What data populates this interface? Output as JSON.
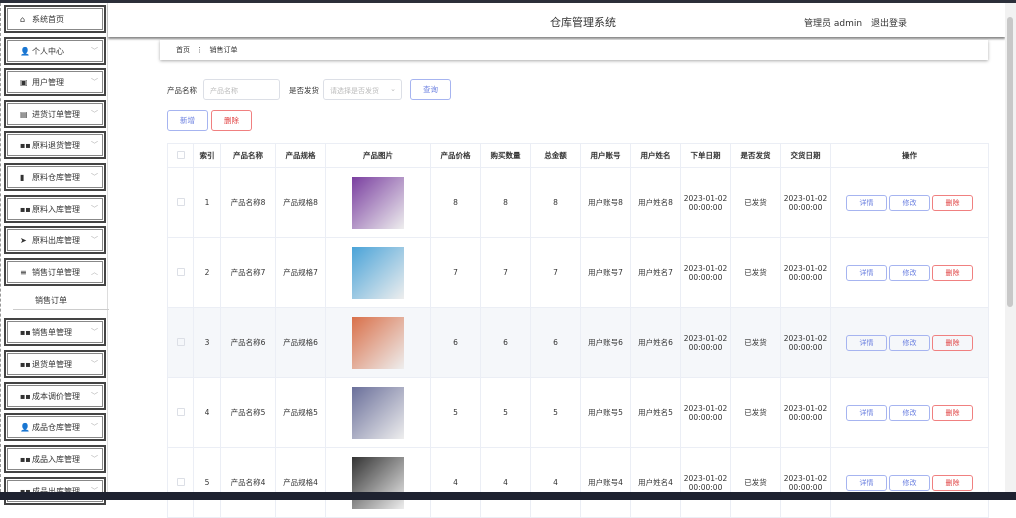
{
  "header": {
    "title": "仓库管理系统",
    "user": "管理员 admin",
    "logout": "退出登录"
  },
  "sidebar": {
    "items": [
      {
        "label": "系统首页",
        "icon": "home-icon"
      },
      {
        "label": "个人中心",
        "icon": "user-icon"
      },
      {
        "label": "用户管理",
        "icon": "picture-icon"
      },
      {
        "label": "进货订单管理",
        "icon": "clipboard-icon"
      },
      {
        "label": "原料退货管理",
        "icon": "grid-icon"
      },
      {
        "label": "原料仓库管理",
        "icon": "chart-icon"
      },
      {
        "label": "原料入库管理",
        "icon": "grid-icon"
      },
      {
        "label": "原料出库管理",
        "icon": "send-icon"
      },
      {
        "label": "销售订单管理",
        "icon": "menu-icon"
      },
      {
        "label": "销售单管理",
        "icon": "grid-icon"
      },
      {
        "label": "退货单管理",
        "icon": "grid-icon"
      },
      {
        "label": "成本调价管理",
        "icon": "grid-icon"
      },
      {
        "label": "成品仓库管理",
        "icon": "user-icon"
      },
      {
        "label": "成品入库管理",
        "icon": "grid-icon"
      },
      {
        "label": "成品出库管理",
        "icon": "grid-icon"
      }
    ],
    "sub_item": "销售订单"
  },
  "breadcrumb": {
    "home": "首页",
    "sep": "⋮",
    "current": "销售订单"
  },
  "search": {
    "name_label": "产品名称",
    "name_placeholder": "产品名称",
    "ship_label": "是否发货",
    "ship_placeholder": "请选择是否发货",
    "query": "查询"
  },
  "actions": {
    "add": "新增",
    "delete": "删除"
  },
  "table": {
    "headers": [
      "索引",
      "产品名称",
      "产品规格",
      "产品图片",
      "产品价格",
      "购买数量",
      "总金额",
      "用户账号",
      "用户姓名",
      "下单日期",
      "是否发货",
      "交货日期",
      "操作"
    ],
    "ops": {
      "detail": "详情",
      "edit": "修改",
      "delete": "删除"
    },
    "rows": [
      {
        "idx": "1",
        "name": "产品名称8",
        "spec": "产品规格8",
        "price": "8",
        "qty": "8",
        "total": "8",
        "account": "用户账号8",
        "uname": "用户姓名8",
        "order_date": "2023-01-02 00:00:00",
        "shipped": "已发货",
        "delivery": "2023-01-02 00:00:00",
        "img": "#7a3fa0"
      },
      {
        "idx": "2",
        "name": "产品名称7",
        "spec": "产品规格7",
        "price": "7",
        "qty": "7",
        "total": "7",
        "account": "用户账号7",
        "uname": "用户姓名7",
        "order_date": "2023-01-02 00:00:00",
        "shipped": "已发货",
        "delivery": "2023-01-02 00:00:00",
        "img": "#4aa3d8"
      },
      {
        "idx": "3",
        "name": "产品名称6",
        "spec": "产品规格6",
        "price": "6",
        "qty": "6",
        "total": "6",
        "account": "用户账号6",
        "uname": "用户姓名6",
        "order_date": "2023-01-02 00:00:00",
        "shipped": "已发货",
        "delivery": "2023-01-02 00:00:00",
        "img": "#d9704a"
      },
      {
        "idx": "4",
        "name": "产品名称5",
        "spec": "产品规格5",
        "price": "5",
        "qty": "5",
        "total": "5",
        "account": "用户账号5",
        "uname": "用户姓名5",
        "order_date": "2023-01-02 00:00:00",
        "shipped": "已发货",
        "delivery": "2023-01-02 00:00:00",
        "img": "#6a6f9a"
      },
      {
        "idx": "5",
        "name": "产品名称4",
        "spec": "产品规格4",
        "price": "4",
        "qty": "4",
        "total": "4",
        "account": "用户账号4",
        "uname": "用户姓名4",
        "order_date": "2023-01-02 00:00:00",
        "shipped": "已发货",
        "delivery": "2023-01-02 00:00:00",
        "img": "#333333"
      }
    ]
  }
}
